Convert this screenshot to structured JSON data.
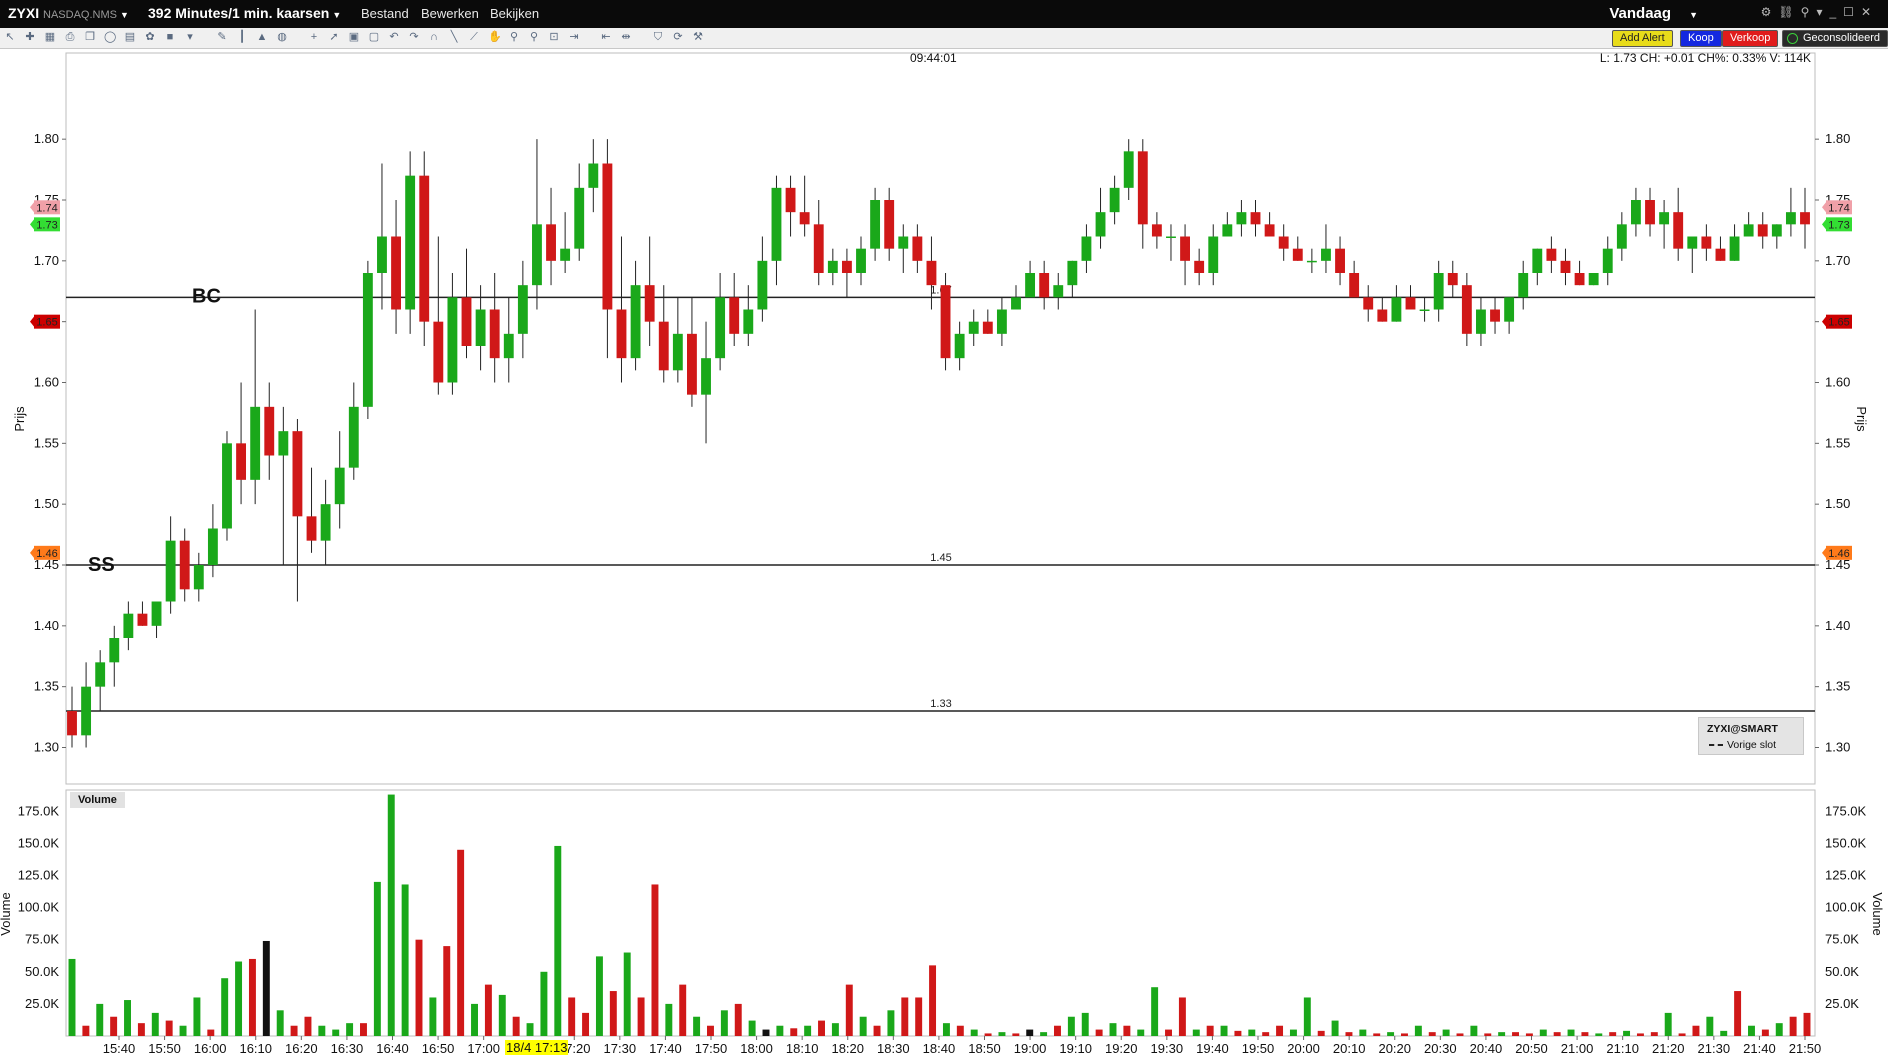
{
  "topbar": {
    "symbol": "ZYXI",
    "exchange": "NASDAQ.NMS",
    "period": "392 Minutes/1 min. kaarsen",
    "menu": [
      "Bestand",
      "Bewerken",
      "Bekijken"
    ],
    "range": "Vandaag"
  },
  "toolbar": {
    "icons": [
      "cursor-icon",
      "crosshair-icon",
      "table-icon",
      "print-icon",
      "copy-icon",
      "circle-icon",
      "grid-icon",
      "palette-icon",
      "square-icon",
      "dropdown-icon",
      "pencil-icon",
      "bars-icon",
      "mountain-icon",
      "globe-icon",
      "plus-icon",
      "arrow-icon",
      "zoom-in-icon",
      "zoom-out-icon",
      "undo-icon",
      "redo-icon",
      "magnet-icon",
      "line-icon",
      "ray-icon",
      "hand-icon",
      "search-icon",
      "search-minus-icon",
      "fit-icon",
      "shrink-icon",
      "expand-icon",
      "scroll-icon",
      "shield-icon",
      "refresh-icon",
      "wrench-icon"
    ],
    "add_alert": "Add Alert",
    "buy": "Koop",
    "sell": "Verkoop",
    "consolidated": "Geconsolideerd"
  },
  "header": {
    "clock": "09:44:01",
    "info": "L: 1.73 CH: +0.01 CH%: 0.33%  V: 114K"
  },
  "legend": {
    "title": "ZYXI@SMART",
    "prev_close": "Vorige slot"
  },
  "volume_panel": {
    "title": "Volume"
  },
  "price_labels": {
    "left_tags": [
      {
        "text": "1.74",
        "price": 1.744,
        "color": "#f0a0a8"
      },
      {
        "text": "1.73",
        "price": 1.73,
        "color": "#33dd33"
      },
      {
        "text": "1.65",
        "price": 1.65,
        "color": "#cc0000"
      },
      {
        "text": "1.46",
        "price": 1.46,
        "color": "#ff7a1a"
      }
    ]
  },
  "annotations": {
    "bc": "BC",
    "ss": "SS"
  },
  "x_highlight": "18/4 17:13",
  "chart_data": [
    {
      "type": "candlestick",
      "ylabel": "Prijs",
      "ylim": [
        1.27,
        1.87
      ],
      "yticks": [
        "1.30",
        "1.35",
        "1.40",
        "1.45",
        "1.50",
        "1.55",
        "1.60",
        "1.65",
        "1.70",
        "1.75",
        "1.80"
      ],
      "xticks": [
        "15:40",
        "15:50",
        "16:00",
        "16:10",
        "16:20",
        "16:30",
        "16:40",
        "16:50",
        "17:00",
        "17:20",
        "17:30",
        "17:40",
        "17:50",
        "18:00",
        "18:10",
        "18:20",
        "18:30",
        "18:40",
        "18:50",
        "19:00",
        "19:10",
        "19:20",
        "19:30",
        "19:40",
        "19:50",
        "20:00",
        "20:10",
        "20:20",
        "20:30",
        "20:40",
        "20:50",
        "21:00",
        "21:10",
        "21:20",
        "21:30",
        "21:40",
        "21:50"
      ],
      "horizontal_lines": [
        {
          "value": 1.67,
          "label": "1.67"
        },
        {
          "value": 1.45,
          "label": "1.45"
        },
        {
          "value": 1.33,
          "label": "1.33"
        }
      ],
      "candles": [
        [
          1.33,
          1.35,
          1.3,
          1.31
        ],
        [
          1.31,
          1.37,
          1.3,
          1.35
        ],
        [
          1.35,
          1.38,
          1.33,
          1.37
        ],
        [
          1.37,
          1.4,
          1.35,
          1.39
        ],
        [
          1.39,
          1.42,
          1.38,
          1.41
        ],
        [
          1.41,
          1.42,
          1.4,
          1.4
        ],
        [
          1.4,
          1.42,
          1.39,
          1.42
        ],
        [
          1.42,
          1.49,
          1.41,
          1.47
        ],
        [
          1.47,
          1.48,
          1.42,
          1.43
        ],
        [
          1.43,
          1.46,
          1.42,
          1.45
        ],
        [
          1.45,
          1.5,
          1.44,
          1.48
        ],
        [
          1.48,
          1.56,
          1.47,
          1.55
        ],
        [
          1.55,
          1.6,
          1.5,
          1.52
        ],
        [
          1.52,
          1.66,
          1.5,
          1.58
        ],
        [
          1.58,
          1.6,
          1.52,
          1.54
        ],
        [
          1.54,
          1.58,
          1.45,
          1.56
        ],
        [
          1.56,
          1.57,
          1.42,
          1.49
        ],
        [
          1.49,
          1.53,
          1.46,
          1.47
        ],
        [
          1.47,
          1.52,
          1.45,
          1.5
        ],
        [
          1.5,
          1.56,
          1.48,
          1.53
        ],
        [
          1.53,
          1.6,
          1.52,
          1.58
        ],
        [
          1.58,
          1.7,
          1.57,
          1.69
        ],
        [
          1.69,
          1.78,
          1.66,
          1.72
        ],
        [
          1.72,
          1.75,
          1.64,
          1.66
        ],
        [
          1.66,
          1.79,
          1.64,
          1.77
        ],
        [
          1.77,
          1.79,
          1.63,
          1.65
        ],
        [
          1.65,
          1.72,
          1.59,
          1.6
        ],
        [
          1.6,
          1.69,
          1.59,
          1.67
        ],
        [
          1.67,
          1.71,
          1.62,
          1.63
        ],
        [
          1.63,
          1.68,
          1.61,
          1.66
        ],
        [
          1.66,
          1.69,
          1.6,
          1.62
        ],
        [
          1.62,
          1.67,
          1.6,
          1.64
        ],
        [
          1.64,
          1.7,
          1.62,
          1.68
        ],
        [
          1.68,
          1.8,
          1.66,
          1.73
        ],
        [
          1.73,
          1.76,
          1.68,
          1.7
        ],
        [
          1.7,
          1.74,
          1.69,
          1.71
        ],
        [
          1.71,
          1.78,
          1.7,
          1.76
        ],
        [
          1.76,
          1.8,
          1.74,
          1.78
        ],
        [
          1.78,
          1.8,
          1.62,
          1.66
        ],
        [
          1.66,
          1.72,
          1.6,
          1.62
        ],
        [
          1.62,
          1.7,
          1.61,
          1.68
        ],
        [
          1.68,
          1.72,
          1.63,
          1.65
        ],
        [
          1.65,
          1.68,
          1.6,
          1.61
        ],
        [
          1.61,
          1.67,
          1.6,
          1.64
        ],
        [
          1.64,
          1.67,
          1.58,
          1.59
        ],
        [
          1.59,
          1.65,
          1.55,
          1.62
        ],
        [
          1.62,
          1.69,
          1.61,
          1.67
        ],
        [
          1.67,
          1.69,
          1.63,
          1.64
        ],
        [
          1.64,
          1.68,
          1.63,
          1.66
        ],
        [
          1.66,
          1.72,
          1.65,
          1.7
        ],
        [
          1.7,
          1.77,
          1.68,
          1.76
        ],
        [
          1.76,
          1.77,
          1.72,
          1.74
        ],
        [
          1.74,
          1.77,
          1.72,
          1.73
        ],
        [
          1.73,
          1.75,
          1.68,
          1.69
        ],
        [
          1.69,
          1.71,
          1.68,
          1.7
        ],
        [
          1.7,
          1.71,
          1.67,
          1.69
        ],
        [
          1.69,
          1.72,
          1.68,
          1.71
        ],
        [
          1.71,
          1.76,
          1.7,
          1.75
        ],
        [
          1.75,
          1.76,
          1.7,
          1.71
        ],
        [
          1.71,
          1.73,
          1.69,
          1.72
        ],
        [
          1.72,
          1.73,
          1.69,
          1.7
        ],
        [
          1.7,
          1.72,
          1.66,
          1.68
        ],
        [
          1.68,
          1.69,
          1.61,
          1.62
        ],
        [
          1.62,
          1.65,
          1.61,
          1.64
        ],
        [
          1.64,
          1.66,
          1.63,
          1.65
        ],
        [
          1.65,
          1.66,
          1.64,
          1.64
        ],
        [
          1.64,
          1.67,
          1.63,
          1.66
        ],
        [
          1.66,
          1.68,
          1.66,
          1.67
        ],
        [
          1.67,
          1.7,
          1.67,
          1.69
        ],
        [
          1.69,
          1.7,
          1.66,
          1.67
        ],
        [
          1.67,
          1.69,
          1.66,
          1.68
        ],
        [
          1.68,
          1.7,
          1.67,
          1.7
        ],
        [
          1.7,
          1.73,
          1.69,
          1.72
        ],
        [
          1.72,
          1.76,
          1.71,
          1.74
        ],
        [
          1.74,
          1.77,
          1.73,
          1.76
        ],
        [
          1.76,
          1.8,
          1.75,
          1.79
        ],
        [
          1.79,
          1.8,
          1.71,
          1.73
        ],
        [
          1.73,
          1.74,
          1.71,
          1.72
        ],
        [
          1.72,
          1.73,
          1.7,
          1.72
        ],
        [
          1.72,
          1.73,
          1.68,
          1.7
        ],
        [
          1.7,
          1.71,
          1.68,
          1.69
        ],
        [
          1.69,
          1.73,
          1.68,
          1.72
        ],
        [
          1.72,
          1.74,
          1.72,
          1.73
        ],
        [
          1.73,
          1.75,
          1.72,
          1.74
        ],
        [
          1.74,
          1.75,
          1.72,
          1.73
        ],
        [
          1.73,
          1.74,
          1.72,
          1.72
        ],
        [
          1.72,
          1.73,
          1.7,
          1.71
        ],
        [
          1.71,
          1.72,
          1.7,
          1.7
        ],
        [
          1.7,
          1.71,
          1.69,
          1.7
        ],
        [
          1.7,
          1.73,
          1.69,
          1.71
        ],
        [
          1.71,
          1.72,
          1.68,
          1.69
        ],
        [
          1.69,
          1.7,
          1.67,
          1.67
        ],
        [
          1.67,
          1.68,
          1.65,
          1.66
        ],
        [
          1.66,
          1.67,
          1.65,
          1.65
        ],
        [
          1.65,
          1.68,
          1.65,
          1.67
        ],
        [
          1.67,
          1.68,
          1.66,
          1.66
        ],
        [
          1.66,
          1.67,
          1.65,
          1.66
        ],
        [
          1.66,
          1.7,
          1.65,
          1.69
        ],
        [
          1.69,
          1.7,
          1.67,
          1.68
        ],
        [
          1.68,
          1.69,
          1.63,
          1.64
        ],
        [
          1.64,
          1.67,
          1.63,
          1.66
        ],
        [
          1.66,
          1.67,
          1.64,
          1.65
        ],
        [
          1.65,
          1.67,
          1.64,
          1.67
        ],
        [
          1.67,
          1.7,
          1.66,
          1.69
        ],
        [
          1.69,
          1.71,
          1.68,
          1.71
        ],
        [
          1.71,
          1.72,
          1.69,
          1.7
        ],
        [
          1.7,
          1.71,
          1.68,
          1.69
        ],
        [
          1.69,
          1.7,
          1.68,
          1.68
        ],
        [
          1.68,
          1.69,
          1.68,
          1.69
        ],
        [
          1.69,
          1.72,
          1.68,
          1.71
        ],
        [
          1.71,
          1.74,
          1.7,
          1.73
        ],
        [
          1.73,
          1.76,
          1.72,
          1.75
        ],
        [
          1.75,
          1.76,
          1.72,
          1.73
        ],
        [
          1.73,
          1.75,
          1.71,
          1.74
        ],
        [
          1.74,
          1.76,
          1.7,
          1.71
        ],
        [
          1.71,
          1.72,
          1.69,
          1.72
        ],
        [
          1.72,
          1.73,
          1.7,
          1.71
        ],
        [
          1.71,
          1.72,
          1.7,
          1.7
        ],
        [
          1.7,
          1.73,
          1.7,
          1.72
        ],
        [
          1.72,
          1.74,
          1.72,
          1.73
        ],
        [
          1.73,
          1.74,
          1.71,
          1.72
        ],
        [
          1.72,
          1.73,
          1.71,
          1.73
        ],
        [
          1.73,
          1.76,
          1.72,
          1.74
        ],
        [
          1.74,
          1.76,
          1.71,
          1.73
        ]
      ]
    },
    {
      "type": "bar",
      "ylabel": "Volume",
      "ylim": [
        0,
        190000
      ],
      "yticks": [
        "25.0K",
        "50.0K",
        "75.0K",
        "100.0K",
        "125.0K",
        "150.0K",
        "175.0K"
      ],
      "values": [
        60000,
        8000,
        25000,
        15000,
        28000,
        10000,
        18000,
        12000,
        8000,
        30000,
        5000,
        45000,
        58000,
        60000,
        74000,
        20000,
        8000,
        15000,
        8000,
        5000,
        10000,
        10000,
        120000,
        188000,
        118000,
        75000,
        30000,
        70000,
        145000,
        25000,
        40000,
        32000,
        15000,
        10000,
        50000,
        148000,
        30000,
        18000,
        62000,
        35000,
        65000,
        30000,
        118000,
        25000,
        40000,
        15000,
        8000,
        20000,
        25000,
        12000,
        5000,
        8000,
        6000,
        8000,
        12000,
        10000,
        40000,
        15000,
        8000,
        20000,
        30000,
        30000,
        55000,
        10000,
        8000,
        5000,
        2000,
        3000,
        2000,
        5000,
        3000,
        8000,
        15000,
        18000,
        5000,
        10000,
        8000,
        5000,
        38000,
        5000,
        30000,
        5000,
        8000,
        8000,
        4000,
        5000,
        3000,
        8000,
        5000,
        30000,
        4000,
        12000,
        3000,
        5000,
        2000,
        3000,
        2000,
        8000,
        3000,
        5000,
        2000,
        8000,
        2000,
        3000,
        3000,
        2000,
        5000,
        3000,
        5000,
        3000,
        2000,
        3000,
        4000,
        2000,
        3000,
        18000,
        2000,
        8000,
        15000,
        4000,
        35000,
        8000,
        5000,
        10000,
        15000,
        18000
      ],
      "colors": [
        "g",
        "r",
        "g",
        "r",
        "g",
        "r",
        "g",
        "r",
        "g",
        "g",
        "r",
        "g",
        "g",
        "r",
        "k",
        "g",
        "r",
        "r",
        "g",
        "g",
        "g",
        "r",
        "g",
        "g",
        "g",
        "r",
        "g",
        "r",
        "r",
        "g",
        "r",
        "g",
        "r",
        "g",
        "g",
        "g",
        "r",
        "r",
        "g",
        "r",
        "g",
        "r",
        "r",
        "g",
        "r",
        "g",
        "r",
        "g",
        "r",
        "g",
        "k",
        "g",
        "r",
        "g",
        "r",
        "g",
        "r",
        "g",
        "r",
        "g",
        "r",
        "r",
        "r",
        "g",
        "r",
        "g",
        "r",
        "g",
        "r",
        "k",
        "g",
        "r",
        "g",
        "g",
        "r",
        "g",
        "r",
        "g",
        "g",
        "r",
        "r",
        "g",
        "r",
        "g",
        "r",
        "g",
        "r",
        "r",
        "g",
        "g",
        "r",
        "g",
        "r",
        "g",
        "r",
        "g",
        "r",
        "g",
        "r",
        "g",
        "r",
        "g",
        "r",
        "g",
        "r",
        "r",
        "g",
        "r",
        "g",
        "r",
        "g",
        "r",
        "g",
        "r",
        "r",
        "g",
        "r",
        "r",
        "g",
        "g",
        "r",
        "g",
        "r",
        "g",
        "r",
        "r"
      ]
    }
  ]
}
